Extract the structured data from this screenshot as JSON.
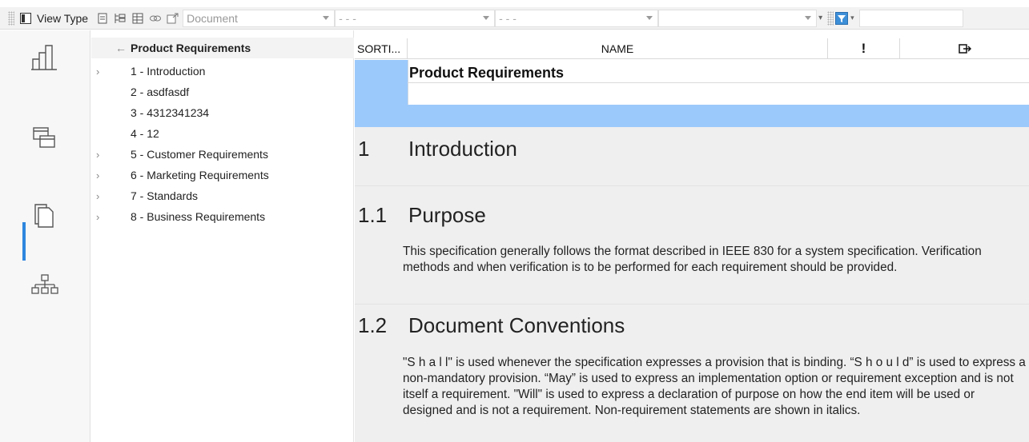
{
  "toolbar": {
    "view_type_label": "View Type",
    "document_combo": "Document",
    "combo2": "- - -",
    "combo3": "- - -",
    "combo4": "",
    "combo5": ""
  },
  "rail": {
    "items": [
      "chart-view-icon",
      "window-view-icon",
      "document-view-icon",
      "hierarchy-view-icon"
    ],
    "active_index": 2
  },
  "tree": {
    "back_arrow": "←",
    "root": "Product Requirements",
    "items": [
      {
        "label": "1 - Introduction",
        "expandable": true
      },
      {
        "label": "2 - asdfasdf",
        "expandable": false
      },
      {
        "label": "3 - 4312341234",
        "expandable": false
      },
      {
        "label": "4 - 12",
        "expandable": false
      },
      {
        "label": "5 - Customer Requirements",
        "expandable": true
      },
      {
        "label": "6 - Marketing Requirements",
        "expandable": true
      },
      {
        "label": "7 - Standards",
        "expandable": true
      },
      {
        "label": "8 - Business Requirements",
        "expandable": true
      }
    ]
  },
  "grid": {
    "columns": [
      "SORTI...",
      "NAME",
      "!",
      "⮊"
    ]
  },
  "document": {
    "title": "Product Requirements",
    "sections": [
      {
        "num": "1",
        "title": "Introduction",
        "body": ""
      },
      {
        "num": "1.1",
        "title": "Purpose",
        "body": "This specification generally follows the format described in IEEE 830 for a system specification. Verification methods and when verification is to be performed for each requirement should be provided."
      },
      {
        "num": "1.2",
        "title": "Document Conventions",
        "body": "\"S h a l l\" is used whenever the specification expresses a provision that is binding. “S h o u l d” is used to express a non-mandatory provision. “May” is used to express an implementation option or requirement exception and is not itself a requirement.  \"Will\" is used to express a declaration of purpose on how the end item will be used or designed and is not a requirement.  Non-requirement statements are shown in italics."
      }
    ]
  },
  "colors": {
    "selection": "#9cc9fb",
    "rail_active": "#2e86de",
    "doc_bg": "#efefef"
  }
}
